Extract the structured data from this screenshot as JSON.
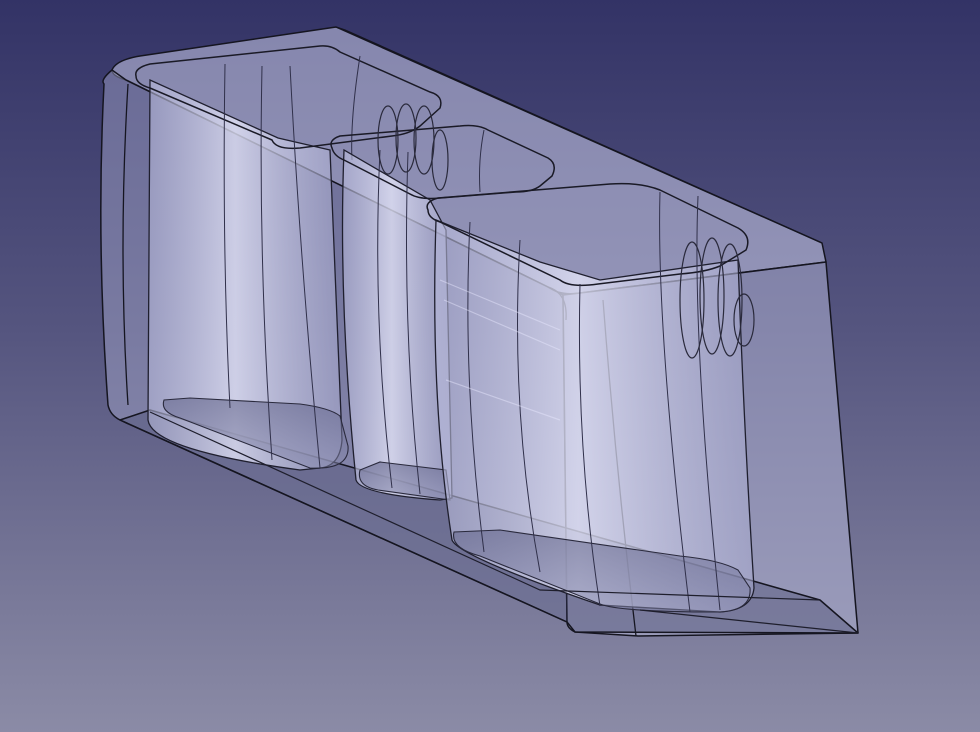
{
  "viewport": {
    "background_top": "#333366",
    "background_bottom": "#8b8ba6",
    "model": {
      "type": "transparent-solid",
      "pocket_count": 3,
      "clip_count": 2,
      "body_color": "#c7c9e6",
      "pocket_wall_color": "#d4d6f0",
      "edge_color": "#151520"
    }
  }
}
